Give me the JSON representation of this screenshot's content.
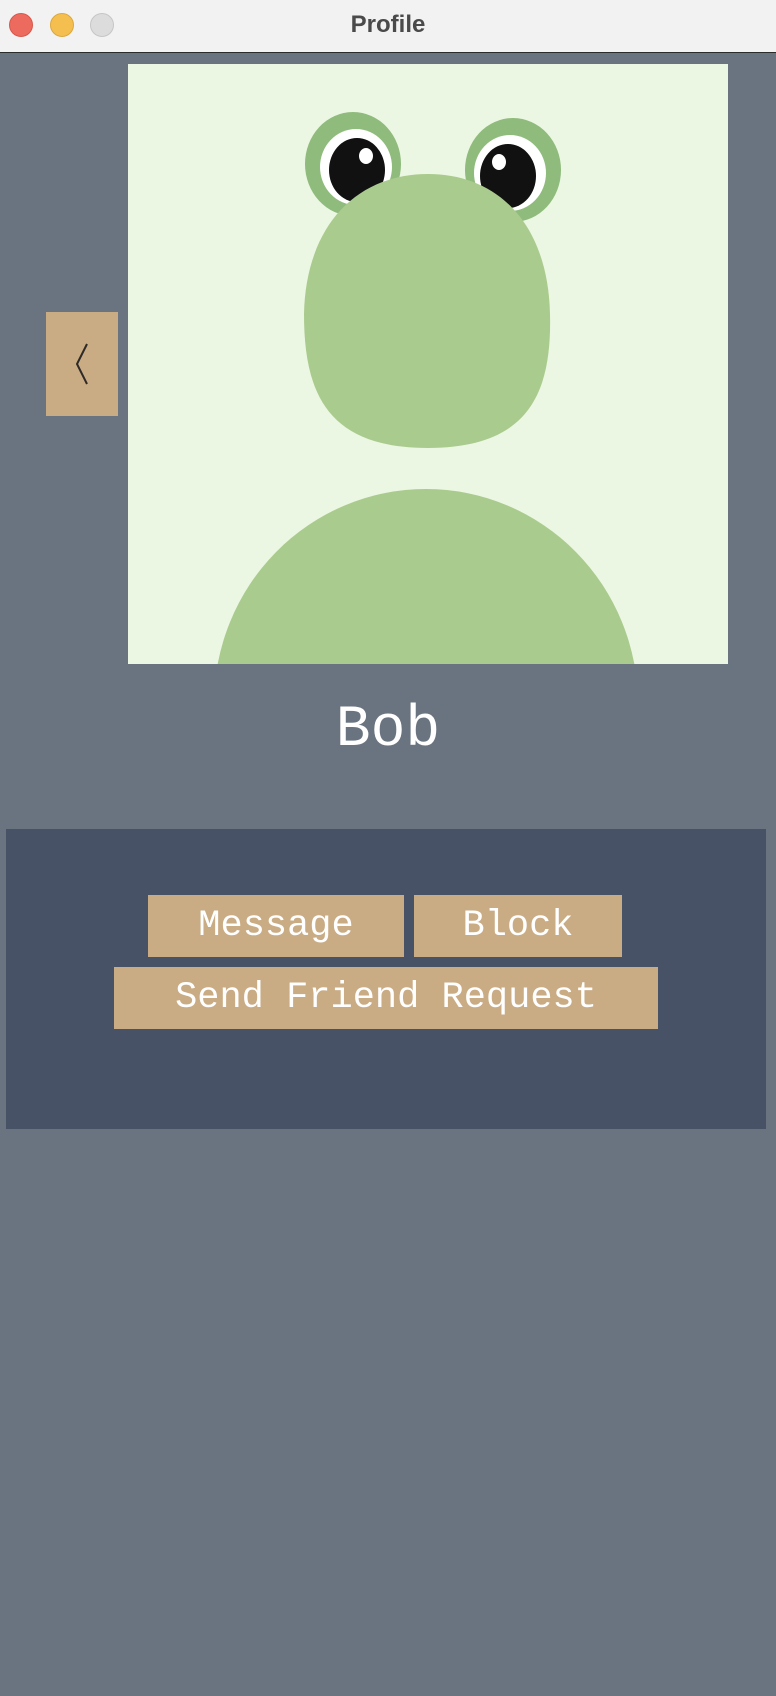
{
  "window": {
    "title": "Profile",
    "controls": [
      "close",
      "minimize",
      "zoom"
    ]
  },
  "navigation": {
    "back_icon": "chevron-left-icon"
  },
  "profile": {
    "avatar_icon": "frog-avatar",
    "username": "Bob"
  },
  "actions": {
    "message_label": "Message",
    "block_label": "Block",
    "friend_request_label": "Send Friend Request"
  },
  "colors": {
    "background": "#6a7480",
    "panel": "#485266",
    "button": "#c9ab84",
    "avatar_background": "#ebf7e2",
    "frog_green": "#aacb8e"
  }
}
